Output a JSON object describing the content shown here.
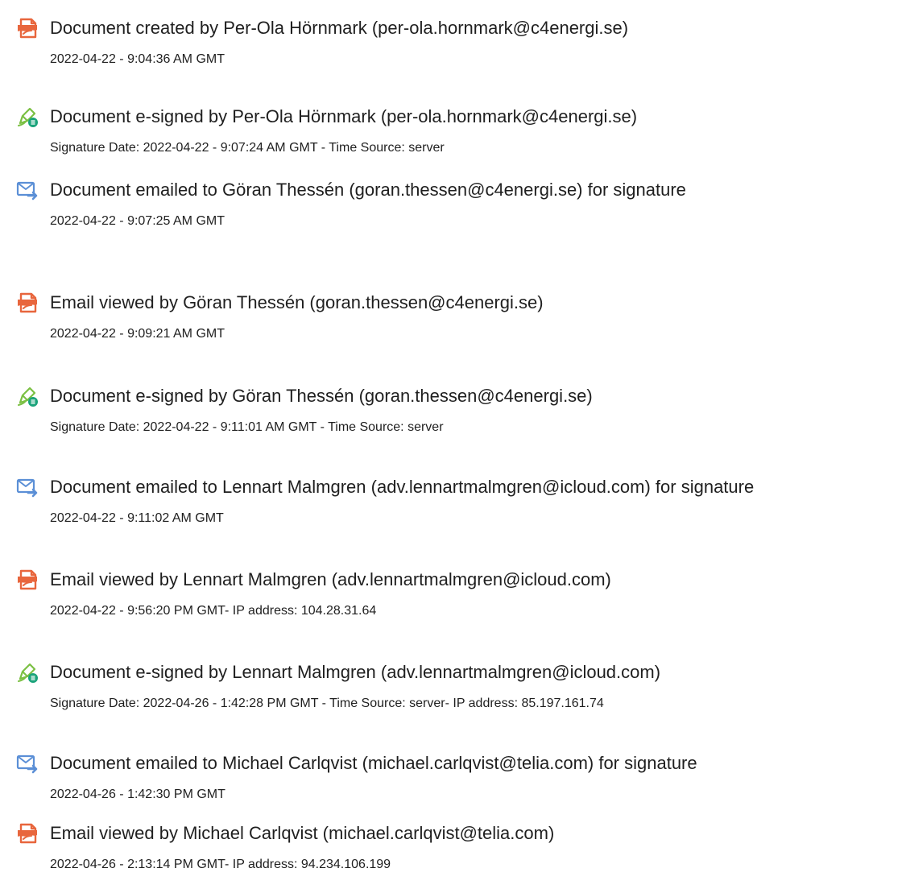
{
  "colors": {
    "document_icon": "#e8663d",
    "signature_icon": "#7bc043",
    "signature_badge": "#1aa37a",
    "email_icon": "#5b8fd6"
  },
  "entries": [
    {
      "icon": "document-icon",
      "title": "Document created by Per-Ola Hörnmark (per-ola.hornmark@c4energi.se)",
      "detail": "2022-04-22 - 9:04:36 AM GMT"
    },
    {
      "icon": "e-signature-icon",
      "title": "Document e-signed by Per-Ola Hörnmark (per-ola.hornmark@c4energi.se)",
      "detail": "Signature Date: 2022-04-22 - 9:07:24 AM GMT - Time Source: server"
    },
    {
      "icon": "email-icon",
      "title": "Document emailed to Göran Thessén (goran.thessen@c4energi.se) for signature",
      "detail": "2022-04-22 - 9:07:25 AM GMT"
    },
    {
      "icon": "document-icon",
      "title": "Email viewed by Göran Thessén (goran.thessen@c4energi.se)",
      "detail": "2022-04-22 - 9:09:21 AM GMT"
    },
    {
      "icon": "e-signature-icon",
      "title": "Document e-signed by Göran Thessén (goran.thessen@c4energi.se)",
      "detail": "Signature Date: 2022-04-22 - 9:11:01 AM GMT - Time Source: server"
    },
    {
      "icon": "email-icon",
      "title": "Document emailed to Lennart Malmgren (adv.lennartmalmgren@icloud.com) for signature",
      "detail": "2022-04-22 - 9:11:02 AM GMT"
    },
    {
      "icon": "document-icon",
      "title": "Email viewed by Lennart Malmgren (adv.lennartmalmgren@icloud.com)",
      "detail": "2022-04-22 - 9:56:20 PM GMT- IP address: 104.28.31.64"
    },
    {
      "icon": "e-signature-icon",
      "title": "Document e-signed by Lennart Malmgren (adv.lennartmalmgren@icloud.com)",
      "detail": "Signature Date: 2022-04-26 - 1:42:28 PM GMT - Time Source: server- IP address: 85.197.161.74"
    },
    {
      "icon": "email-icon",
      "title": "Document emailed to Michael Carlqvist (michael.carlqvist@telia.com) for signature",
      "detail": "2022-04-26 - 1:42:30 PM GMT"
    },
    {
      "icon": "document-icon",
      "title": "Email viewed by Michael Carlqvist (michael.carlqvist@telia.com)",
      "detail": "2022-04-26 - 2:13:14 PM GMT- IP address: 94.234.106.199"
    }
  ]
}
